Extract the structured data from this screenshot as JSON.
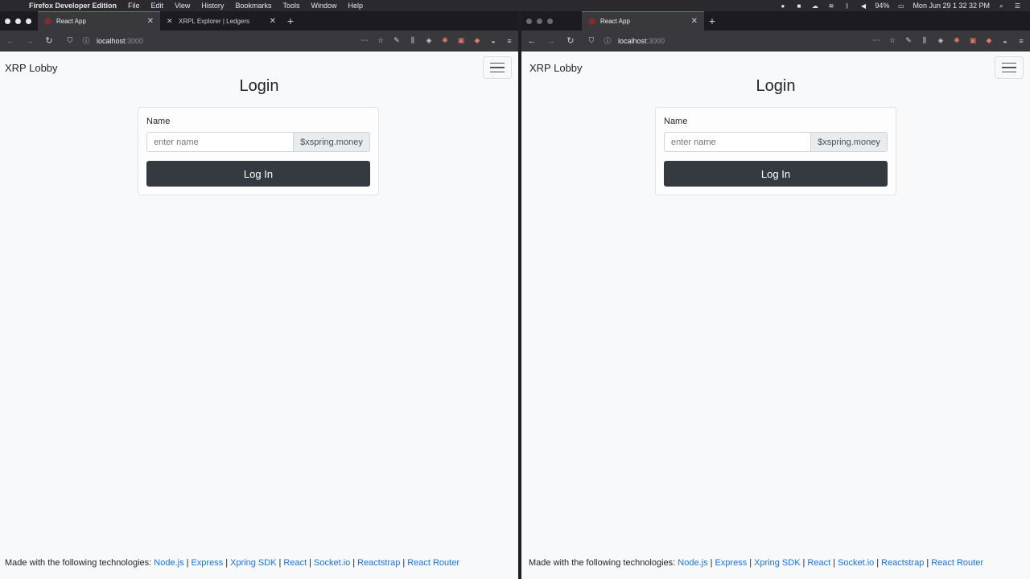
{
  "menubar": {
    "app_name": "Firefox Developer Edition",
    "items": [
      "File",
      "Edit",
      "View",
      "History",
      "Bookmarks",
      "Tools",
      "Window",
      "Help"
    ],
    "battery": "94%",
    "datetime": "Mon Jun 29  1 32 32 PM"
  },
  "left_window": {
    "tabs": [
      {
        "label": "React App",
        "active": true
      },
      {
        "label": "XRPL Explorer | Ledgers",
        "active": false
      }
    ],
    "url_host": "localhost",
    "url_port": ":3000"
  },
  "right_window": {
    "tabs": [
      {
        "label": "React App",
        "active": true
      }
    ],
    "url_host": "localhost",
    "url_port": ":3000"
  },
  "app": {
    "brand": "XRP Lobby",
    "login_title": "Login",
    "name_label": "Name",
    "name_placeholder": "enter name",
    "domain_suffix": "$xspring.money",
    "login_button": "Log In",
    "footer_prefix": "Made with the following technologies:",
    "footer_links": [
      "Node.js",
      "Express",
      "Xpring SDK",
      "React",
      "Socket.io",
      "Reactstrap",
      "React Router"
    ]
  },
  "colors": {
    "link": "#1a73e8",
    "button_dark": "#343a40",
    "tab_accent": "#0a84ff"
  }
}
